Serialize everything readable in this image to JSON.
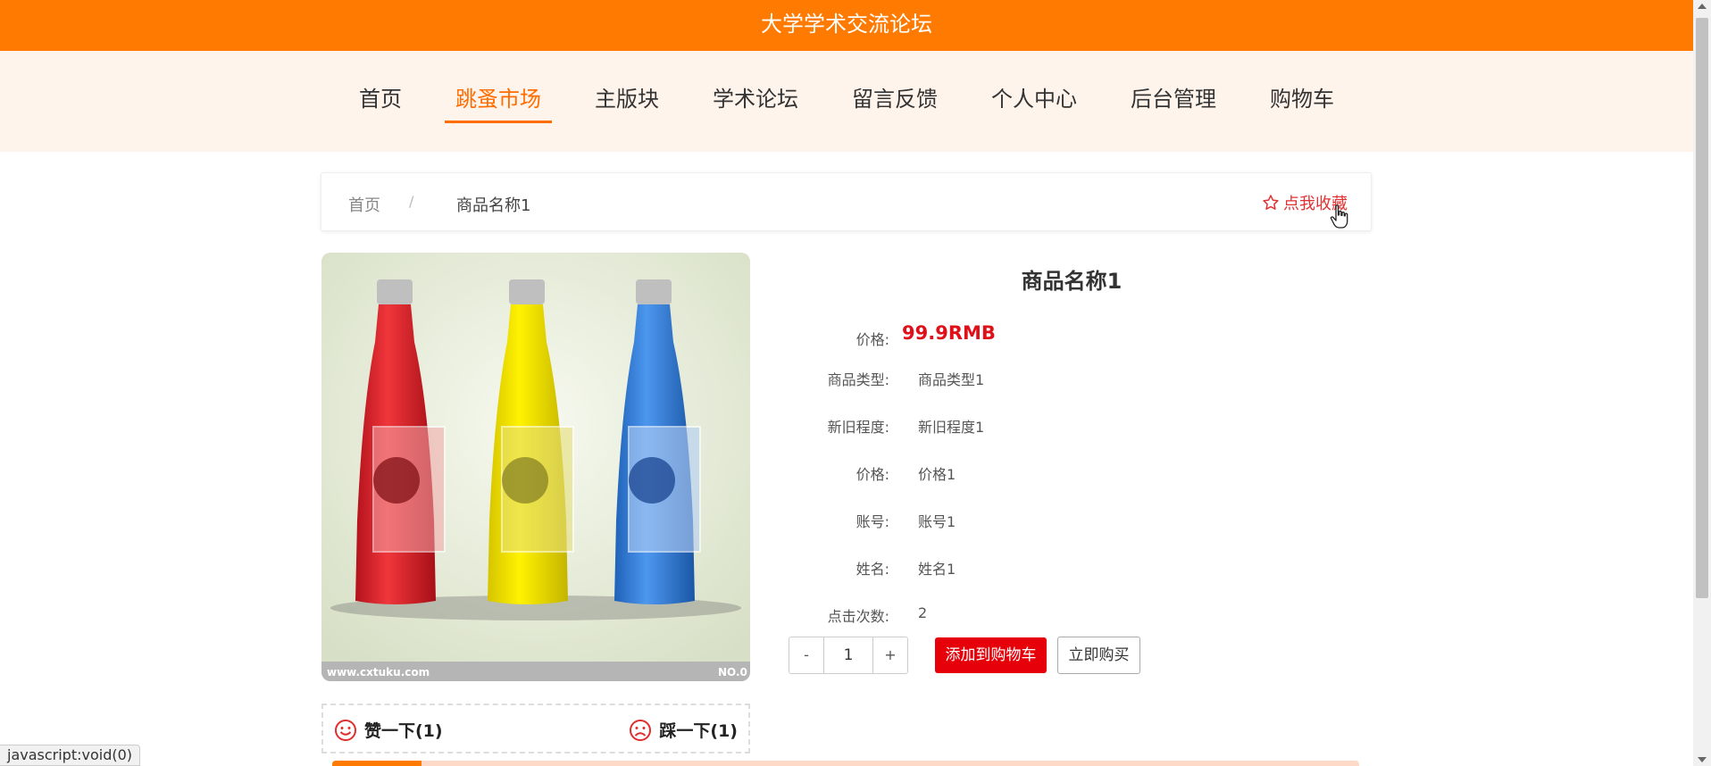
{
  "header": {
    "site_title": "大学学术交流论坛"
  },
  "nav": {
    "items": [
      {
        "label": "首页"
      },
      {
        "label": "跳蚤市场",
        "active": true
      },
      {
        "label": "主版块"
      },
      {
        "label": "学术论坛"
      },
      {
        "label": "留言反馈"
      },
      {
        "label": "个人中心"
      },
      {
        "label": "后台管理"
      },
      {
        "label": "购物车"
      }
    ]
  },
  "breadcrumb": {
    "home": "首页",
    "separator": "/",
    "current": "商品名称1"
  },
  "favorite": {
    "label": "点我收藏",
    "icon": "star-outline-icon"
  },
  "product": {
    "name": "商品名称1",
    "price_label": "价格:",
    "price_value": "99.9RMB",
    "fields": [
      {
        "label": "商品类型:",
        "value": "商品类型1"
      },
      {
        "label": "新旧程度:",
        "value": "新旧程度1"
      },
      {
        "label": "价格:",
        "value": "价格1"
      },
      {
        "label": "账号:",
        "value": "账号1"
      },
      {
        "label": "姓名:",
        "value": "姓名1"
      },
      {
        "label": "点击次数:",
        "value": "2"
      }
    ],
    "image": {
      "watermark_left": "www.cxtuku.com",
      "watermark_right": "NO.0"
    }
  },
  "purchase": {
    "minus": "-",
    "quantity": "1",
    "plus": "+",
    "add_to_cart": "添加到购物车",
    "buy_now": "立即购买"
  },
  "votes": {
    "like": "赞一下(1)",
    "dislike": "踩一下(1)"
  },
  "statusbar": {
    "text": "javascript:void(0)"
  },
  "colors": {
    "brand": "#ff7a00",
    "nav_active": "#ff6d00",
    "price": "#e0101a",
    "cart_button": "#e5000a"
  }
}
